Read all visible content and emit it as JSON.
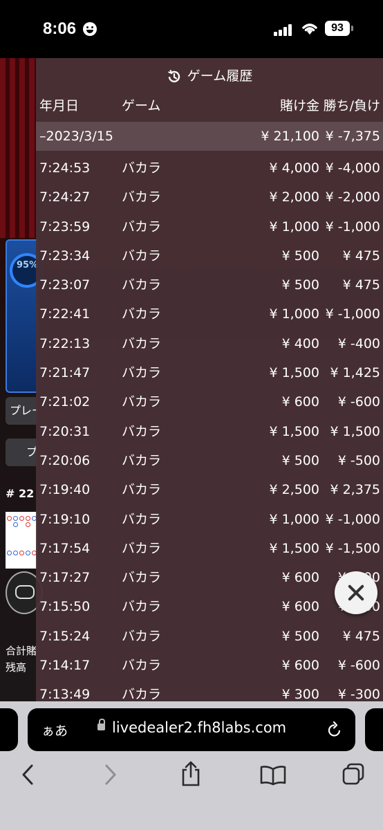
{
  "status_bar": {
    "time": "8:06",
    "battery": "93"
  },
  "background": {
    "percent": "95%",
    "play_button_1": "プレー",
    "play_button_2": "プ",
    "round_label": "# 22",
    "total_bet_label": "合計賭",
    "balance_label": "残高"
  },
  "history": {
    "title": "ゲーム履歴",
    "columns": {
      "date": "年月日",
      "game": "ゲーム",
      "bet": "賭け金",
      "win": "勝ち/負け"
    },
    "summary": {
      "date": "–2023/3/15",
      "bet": "¥ 21,100",
      "win": "¥ -7,375"
    },
    "rows": [
      {
        "time": "7:24:53",
        "game": "バカラ",
        "bet": "¥ 4,000",
        "win": "¥ -4,000"
      },
      {
        "time": "7:24:27",
        "game": "バカラ",
        "bet": "¥ 2,000",
        "win": "¥ -2,000"
      },
      {
        "time": "7:23:59",
        "game": "バカラ",
        "bet": "¥ 1,000",
        "win": "¥ -1,000"
      },
      {
        "time": "7:23:34",
        "game": "バカラ",
        "bet": "¥ 500",
        "win": "¥ 475"
      },
      {
        "time": "7:23:07",
        "game": "バカラ",
        "bet": "¥ 500",
        "win": "¥ 475"
      },
      {
        "time": "7:22:41",
        "game": "バカラ",
        "bet": "¥ 1,000",
        "win": "¥ -1,000"
      },
      {
        "time": "7:22:13",
        "game": "バカラ",
        "bet": "¥ 400",
        "win": "¥ -400"
      },
      {
        "time": "7:21:47",
        "game": "バカラ",
        "bet": "¥ 1,500",
        "win": "¥ 1,425"
      },
      {
        "time": "7:21:02",
        "game": "バカラ",
        "bet": "¥ 600",
        "win": "¥ -600"
      },
      {
        "time": "7:20:31",
        "game": "バカラ",
        "bet": "¥ 1,500",
        "win": "¥ 1,500"
      },
      {
        "time": "7:20:06",
        "game": "バカラ",
        "bet": "¥ 500",
        "win": "¥ -500"
      },
      {
        "time": "7:19:40",
        "game": "バカラ",
        "bet": "¥ 2,500",
        "win": "¥ 2,375"
      },
      {
        "time": "7:19:10",
        "game": "バカラ",
        "bet": "¥ 1,000",
        "win": "¥ -1,000"
      },
      {
        "time": "7:17:54",
        "game": "バカラ",
        "bet": "¥ 1,500",
        "win": "¥ -1,500"
      },
      {
        "time": "7:17:27",
        "game": "バカラ",
        "bet": "¥ 600",
        "win": "¥ -600"
      },
      {
        "time": "7:15:50",
        "game": "バカラ",
        "bet": "¥ 600",
        "win": "¥ -600"
      },
      {
        "time": "7:15:24",
        "game": "バカラ",
        "bet": "¥ 500",
        "win": "¥ 475"
      },
      {
        "time": "7:14:17",
        "game": "バカラ",
        "bet": "¥ 600",
        "win": "¥ -600"
      },
      {
        "time": "7:13:49",
        "game": "バカラ",
        "bet": "¥ 300",
        "win": "¥ -300"
      }
    ]
  },
  "browser": {
    "aa_label": "ぁあ",
    "url": "livedealer2.fh8labs.com"
  },
  "colors": {
    "panel": "#483036",
    "summary": "#5f4a50",
    "accent_blue": "#2e86ff"
  }
}
